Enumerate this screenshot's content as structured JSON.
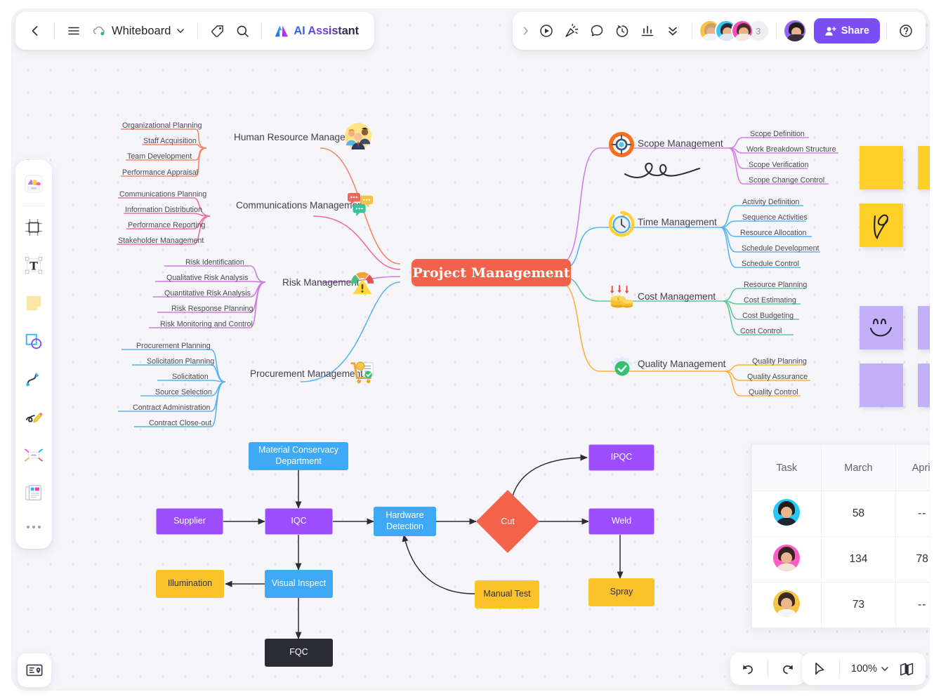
{
  "app": {
    "doc_title": "Whiteboard",
    "ai_assistant_label": "AI Assistant"
  },
  "toolbar_left": {
    "back_icon": "chevron-left-icon",
    "menu_icon": "hamburger-menu-icon",
    "cloud_icon": "cloud-saved-icon",
    "chevron_icon": "chevron-down-icon",
    "tag_icon": "tag-icon",
    "search_icon": "search-icon",
    "ai_logo_icon": "ai-sparkle-logo-icon"
  },
  "toolbar_right": {
    "expand_icon": "chevron-right-icon",
    "present_icon": "play-circle-icon",
    "celebrate_icon": "confetti-icon",
    "comment_icon": "comment-bubble-icon",
    "timer_icon": "timer-icon",
    "chart_icon": "bar-chart-icon",
    "more_icon": "double-chevron-down-icon",
    "collaborator_overflow_count": "3",
    "share_label": "Share",
    "share_icon": "add-person-icon",
    "help_icon": "help-circle-icon",
    "collaborators": [
      {
        "name": "collaborator-1",
        "ring": "#f6c445",
        "hair": "#caa16e",
        "body": "#f2f4f7"
      },
      {
        "name": "collaborator-2",
        "ring": "#39c5f3",
        "hair": "#2b2b33",
        "body": "#dfe6ee"
      },
      {
        "name": "collaborator-3",
        "ring": "#f84ec0",
        "hair": "#4a2f24",
        "body": "#f6eadf"
      }
    ],
    "current_user": {
      "name": "current-user",
      "ring": "#9a63f8",
      "hair": "#211d1c",
      "body": "#3a2f3d"
    }
  },
  "tool_rail": {
    "items": [
      {
        "name": "templates-tool",
        "icon": "templates-icon"
      },
      {
        "name": "frame-tool",
        "icon": "frame-icon"
      },
      {
        "name": "text-tool",
        "icon": "text-t-icon"
      },
      {
        "name": "sticky-note-tool",
        "icon": "sticky-note-icon"
      },
      {
        "name": "shape-tool",
        "icon": "shapes-icon"
      },
      {
        "name": "connector-tool",
        "icon": "curved-connector-icon"
      },
      {
        "name": "pen-tool",
        "icon": "pen-scribble-icon"
      },
      {
        "name": "mindmap-tool",
        "icon": "mindmap-icon"
      },
      {
        "name": "document-tool",
        "icon": "document-icon"
      },
      {
        "name": "more-tools",
        "icon": "ellipsis-icon"
      }
    ]
  },
  "bottom_bar": {
    "undo_icon": "undo-arrow-icon",
    "redo_icon": "redo-arrow-icon",
    "cursor_icon": "cursor-pointer-icon",
    "zoom_level": "100%",
    "zoom_chevron_icon": "chevron-down-icon",
    "minimap_icon": "minimap-icon",
    "navigator_icon": "navigator-card-icon"
  },
  "mindmap": {
    "center": "Project Management",
    "center_color": "#f0624b",
    "left_branches": [
      {
        "title": "Human Resource Management",
        "color": "#f4856b",
        "icon": "people-team-icon",
        "leaves": [
          "Organizational Planning",
          "Staff Acquisition",
          "Team Development",
          "Performance Appraisal"
        ]
      },
      {
        "title": "Communications Management",
        "color": "#f56a9a",
        "icon": "speech-bubbles-icon",
        "leaves": [
          "Communications Planning",
          "Information Distribution",
          "Performance Reporting",
          "Stakeholder Management"
        ]
      },
      {
        "title": "Risk Management",
        "color": "#cf7ae0",
        "icon": "risk-gauge-warning-icon",
        "leaves": [
          "Risk Identification",
          "Qualitative Risk Analysis",
          "Quantitative Risk Analysis",
          "Risk Response Planning",
          "Risk Monitoring and Control"
        ]
      },
      {
        "title": "Procurement Management",
        "color": "#5ab4f0",
        "icon": "procurement-cart-icon",
        "leaves": [
          "Procurement Planning",
          "Solicitation Planning",
          "Solicitation",
          "Source Selection",
          "Contract Administration",
          "Contract Close-out"
        ]
      }
    ],
    "right_branches": [
      {
        "title": "Scope Management",
        "color": "#d57ce8",
        "icon": "target-scope-icon",
        "leaves": [
          "Scope Definition",
          "Work Breakdown Structure",
          "Scope Verification",
          "Scope Change Control"
        ]
      },
      {
        "title": "Time Management",
        "color": "#55b6f2",
        "icon": "clock-time-icon",
        "leaves": [
          "Activity Definition",
          "Sequence Activities",
          "Resource Allocation",
          "Schedule Development",
          "Schedule Control"
        ]
      },
      {
        "title": "Cost Management",
        "color": "#5fc79a",
        "icon": "coins-cost-icon",
        "leaves": [
          "Resource Planning",
          "Cost Estimating",
          "Cost Budgeting",
          "Cost Control"
        ]
      },
      {
        "title": "Quality Management",
        "color": "#f7b33c",
        "icon": "check-quality-icon",
        "leaves": [
          "Quality Planning",
          "Quality Assurance",
          "Quality Control"
        ]
      }
    ],
    "annotation": "handwritten-scribble"
  },
  "flowchart": {
    "nodes": [
      {
        "name": "material-conservacy-department-node",
        "label": "Material Conservacy Department",
        "style": "blue"
      },
      {
        "name": "supplier-node",
        "label": "Supplier",
        "style": "purple"
      },
      {
        "name": "iqc-node",
        "label": "IQC",
        "style": "purple"
      },
      {
        "name": "hardware-detection-node",
        "label": "Hardware Detection",
        "style": "blue"
      },
      {
        "name": "cut-node",
        "label": "Cut",
        "style": "diamond"
      },
      {
        "name": "ipqc-node",
        "label": "IPQC",
        "style": "purple"
      },
      {
        "name": "weld-node",
        "label": "Weld",
        "style": "purple"
      },
      {
        "name": "spray-node",
        "label": "Spray",
        "style": "amber"
      },
      {
        "name": "manual-test-node",
        "label": "Manual Test",
        "style": "amber"
      },
      {
        "name": "illumination-node",
        "label": "Illumination",
        "style": "amber"
      },
      {
        "name": "visual-inspect-node",
        "label": "Visual Inspect",
        "style": "blue"
      },
      {
        "name": "fqc-node",
        "label": "FQC",
        "style": "dark"
      }
    ],
    "colors": {
      "blue": "#3fa9f5",
      "purple": "#9b4dff",
      "amber": "#fcc22a",
      "dark": "#2b2b33",
      "diamond": "#f4624a"
    }
  },
  "sticky_notes": [
    {
      "name": "sticky-yellow-1",
      "color": "#ffd028",
      "doodle": "none"
    },
    {
      "name": "sticky-yellow-2",
      "color": "#ffd028",
      "doodle": "none"
    },
    {
      "name": "sticky-yellow-heart",
      "color": "#ffd028",
      "doodle": "heart"
    },
    {
      "name": "sticky-purple-smiley",
      "color": "#c3b0fb",
      "doodle": "smiley"
    },
    {
      "name": "sticky-purple-1",
      "color": "#c3b0fb",
      "doodle": "none"
    },
    {
      "name": "sticky-purple-2",
      "color": "#c3b0fb",
      "doodle": "none"
    },
    {
      "name": "sticky-purple-3",
      "color": "#c3b0fb",
      "doodle": "none"
    }
  ],
  "table": {
    "headers": [
      "Task",
      "March",
      "April"
    ],
    "rows": [
      {
        "avatar": {
          "ring": "#28c6f5",
          "hair": "#221c19",
          "body": "#1f2430"
        },
        "march": "58",
        "april": "--"
      },
      {
        "avatar": {
          "ring": "#f95ec6",
          "hair": "#39221d",
          "body": "#f3e2d5"
        },
        "march": "134",
        "april": "78"
      },
      {
        "avatar": {
          "ring": "#f6c445",
          "hair": "#3a2b20",
          "body": "#f4f5f7"
        },
        "march": "73",
        "april": "--"
      }
    ]
  }
}
